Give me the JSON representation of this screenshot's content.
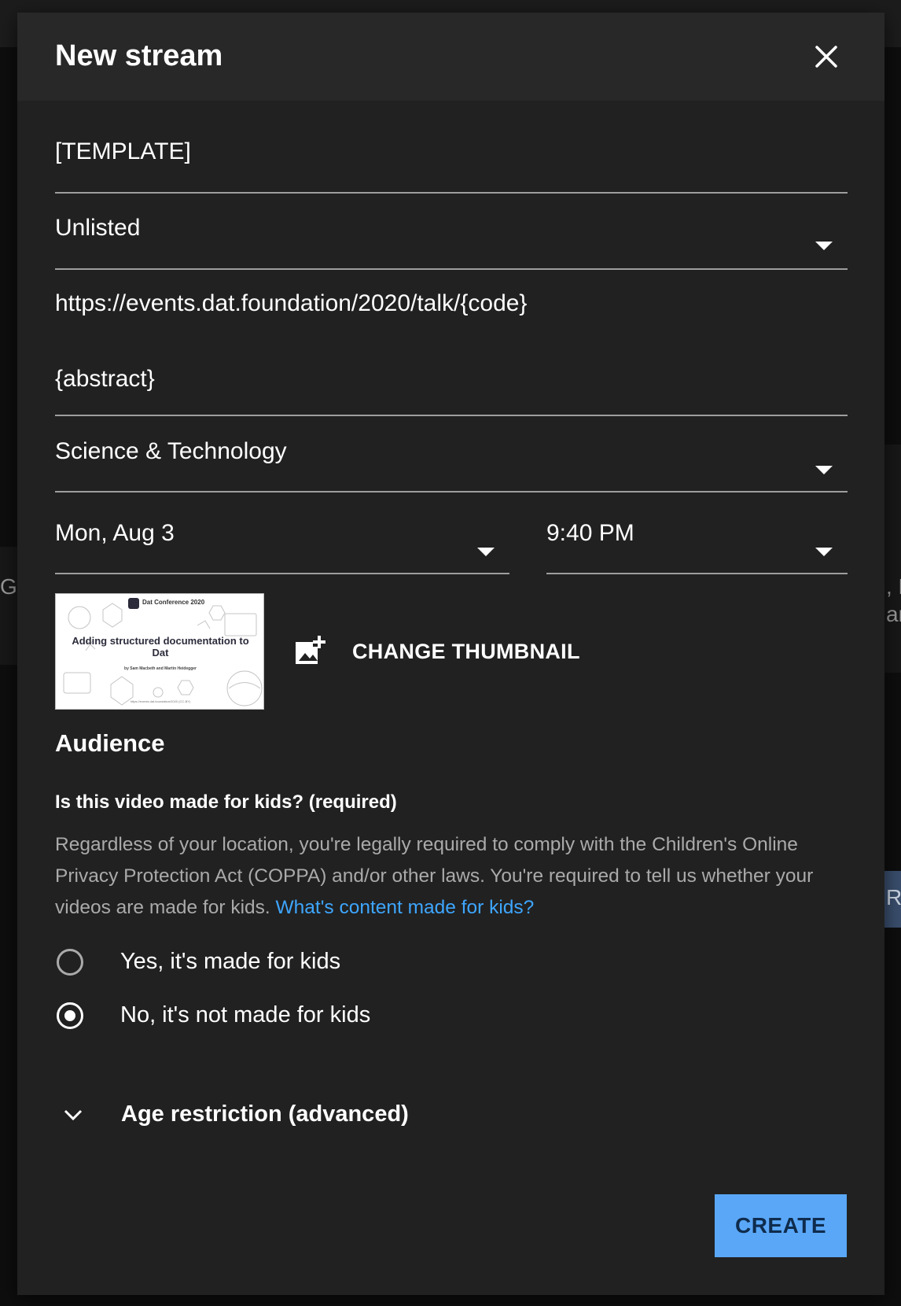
{
  "background": {
    "left_fragment": "GS",
    "right_fragment_1": ", P",
    "right_fragment_2": "ar",
    "right_fragment_3": "RE"
  },
  "dialog": {
    "title": "New stream",
    "close_icon": "close-icon"
  },
  "form": {
    "title_value": "[TEMPLATE]",
    "visibility_value": "Unlisted",
    "description_link_value": "https://events.dat.foundation/2020/talk/{code}",
    "description_body_value": "{abstract}",
    "category_value": "Science & Technology",
    "date_value": "Mon, Aug 3",
    "time_value": "9:40 PM"
  },
  "thumbnail": {
    "conference": "Dat Conference 2020",
    "talk_title": "Adding structured documentation to Dat",
    "authors": "by Sam Macbeth and Martin Heidegger",
    "footer": "https://events.dat.foundation/2020 (CC-BY)",
    "change_label": "CHANGE THUMBNAIL",
    "change_icon": "add-photo-icon"
  },
  "audience": {
    "heading": "Audience",
    "question": "Is this video made for kids? (required)",
    "description": "Regardless of your location, you're legally required to comply with the Children's Online Privacy Protection Act (COPPA) and/or other laws. You're required to tell us whether your videos are made for kids.",
    "help_link": "What's content made for kids?",
    "options": [
      {
        "label": "Yes, it's made for kids",
        "selected": false
      },
      {
        "label": "No, it's not made for kids",
        "selected": true
      }
    ]
  },
  "age_restriction": {
    "label": "Age restriction (advanced)",
    "icon": "chevron-down-icon"
  },
  "actions": {
    "create_label": "CREATE"
  },
  "colors": {
    "dialog_bg": "#212121",
    "header_bg": "#282828",
    "link": "#3ea6ff",
    "primary_button": "#5aa7f8"
  }
}
